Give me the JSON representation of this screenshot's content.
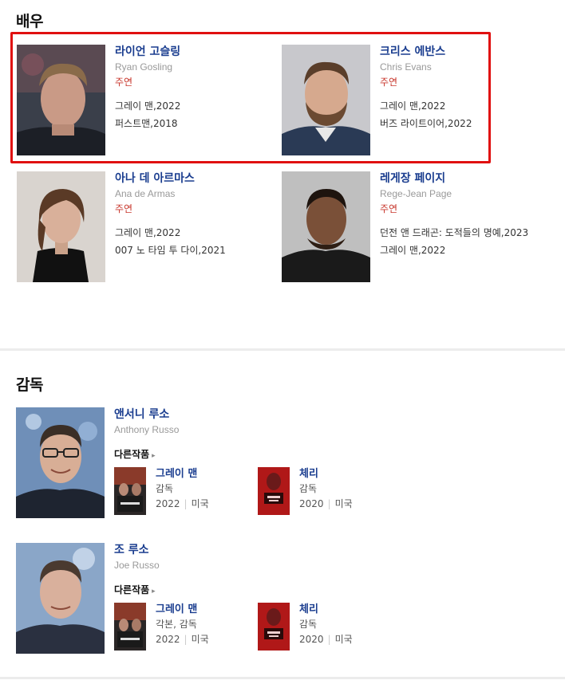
{
  "sections": {
    "actors_title": "배우",
    "directors_title": "감독"
  },
  "actors": [
    {
      "name_ko": "라이언 고슬링",
      "name_en": "Ryan Gosling",
      "role": "주연",
      "works": [
        "그레이 맨,2022",
        "퍼스트맨,2018"
      ]
    },
    {
      "name_ko": "크리스 에반스",
      "name_en": "Chris Evans",
      "role": "주연",
      "works": [
        "그레이 맨,2022",
        "버즈 라이트이어,2022"
      ]
    },
    {
      "name_ko": "아나 데 아르마스",
      "name_en": "Ana de Armas",
      "role": "주연",
      "works": [
        "그레이 맨,2022",
        "007 노 타임 투 다이,2021"
      ]
    },
    {
      "name_ko": "레게장 페이지",
      "name_en": "Rege-Jean Page",
      "role": "주연",
      "works": [
        "던전 앤 드래곤: 도적들의 명예,2023",
        "그레이 맨,2022"
      ]
    }
  ],
  "directors": [
    {
      "name_ko": "앤서니 루소",
      "name_en": "Anthony Russo",
      "other_works_label": "다른작품",
      "works": [
        {
          "title": "그레이 맨",
          "role": "감독",
          "year": "2022",
          "country": "미국"
        },
        {
          "title": "체리",
          "role": "감독",
          "year": "2020",
          "country": "미국"
        }
      ]
    },
    {
      "name_ko": "조 루소",
      "name_en": "Joe Russo",
      "other_works_label": "다른작품",
      "works": [
        {
          "title": "그레이 맨",
          "role": "각본, 감독",
          "year": "2022",
          "country": "미국"
        },
        {
          "title": "체리",
          "role": "감독",
          "year": "2020",
          "country": "미국"
        }
      ]
    }
  ],
  "colors": {
    "highlight_border": "#e01010",
    "name_link": "#1a3d8f",
    "role_text": "#c8372d"
  }
}
